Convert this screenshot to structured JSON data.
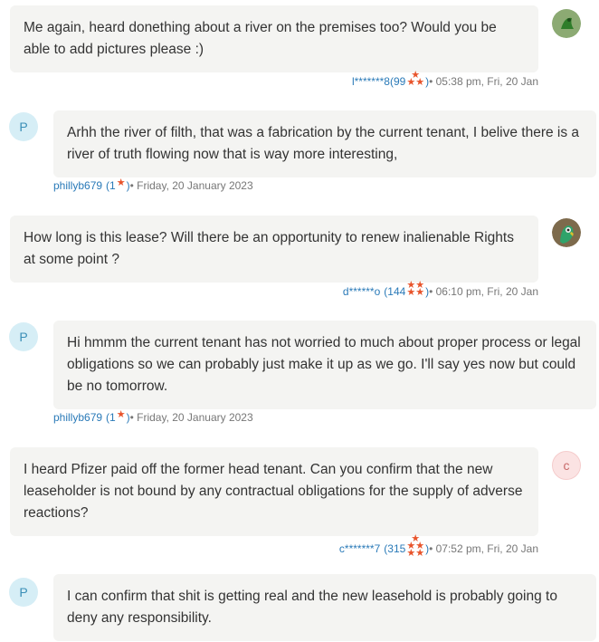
{
  "messages": [
    {
      "side": "right",
      "avatar": "green-lizard",
      "text": "Me again, heard donething about a river on the premises too? Would you be able to add pictures please :)",
      "user": "l*******8",
      "rating": "(99",
      "meta": " • 05:38 pm, Fri, 20 Jan"
    },
    {
      "side": "left",
      "avatar": "P",
      "text": "Arhh the river of filth, that was a fabrication by the current tenant, I belive there is a river of truth flowing now that is way more interesting,",
      "user": "phillyb679",
      "rating": "(1",
      "meta": " • Friday, 20 January 2023"
    },
    {
      "side": "right",
      "avatar": "parrot",
      "text": "How long is this lease? Will there be an opportunity to renew inalienable Rights at some point ?",
      "user": "d******o",
      "rating": "(144",
      "meta": " • 06:10 pm, Fri, 20 Jan"
    },
    {
      "side": "left",
      "avatar": "P",
      "text": "Hi hmmm the current tenant has not worried to much about proper process or legal obligations so we can probably just make it up as we go. I'll say yes now but could be no tomorrow.",
      "user": "phillyb679",
      "rating": "(1",
      "meta": " • Friday, 20 January 2023"
    },
    {
      "side": "right",
      "avatar": "c",
      "text": "I heard Pfizer paid off the former head tenant. Can you confirm that the new leaseholder is not bound by any contractual obligations for the supply of adverse reactions?",
      "user": "c*******7",
      "rating": "(315",
      "meta": " • 07:52 pm, Fri, 20 Jan"
    },
    {
      "side": "left",
      "avatar": "P",
      "text": "I can confirm that shit is getting real and the new leasehold is probably going to deny any responsibility.",
      "user": "",
      "rating": "",
      "meta": ""
    }
  ],
  "star_glyph": "★",
  "close_paren": ")",
  "colors": {
    "star": "#e8542b",
    "link": "#2a7ab8",
    "bubble": "#f4f4f2"
  }
}
